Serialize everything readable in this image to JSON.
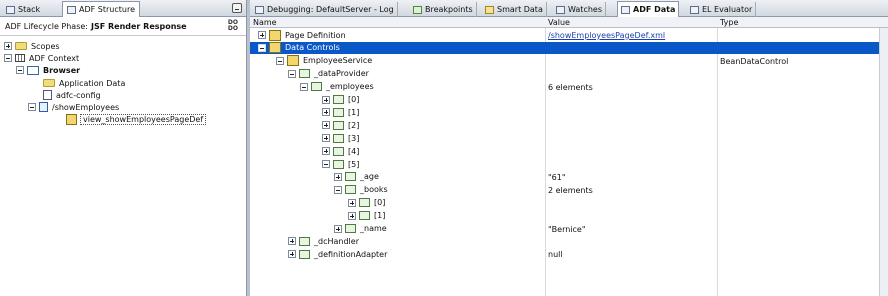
{
  "left_panel": {
    "tabs": [
      {
        "label": "Stack"
      },
      {
        "label": "ADF Structure"
      }
    ],
    "phase_label": "ADF Lifecycle Phase:",
    "phase_value": "JSF Render Response",
    "tree": [
      {
        "label": "Scopes"
      },
      {
        "label": "ADF Context"
      },
      {
        "label": "Browser"
      },
      {
        "label": "Application Data"
      },
      {
        "label": "adfc-config"
      },
      {
        "label": "/showEmployees"
      },
      {
        "label": "view_showEmployeesPageDef"
      }
    ]
  },
  "right_panel": {
    "tabs": [
      {
        "label": "Debugging: DefaultServer - Log"
      },
      {
        "label": "Breakpoints"
      },
      {
        "label": "Smart Data"
      },
      {
        "label": "Watches"
      },
      {
        "label": "ADF Data"
      },
      {
        "label": "EL Evaluator"
      }
    ],
    "columns": {
      "name": "Name",
      "value": "Value",
      "type": "Type"
    },
    "rows": [
      {
        "name": "Page Definition",
        "value": "/showEmployeesPageDef.xml",
        "type": ""
      },
      {
        "name": "Data Controls",
        "value": "",
        "type": ""
      },
      {
        "name": "EmployeeService",
        "value": "",
        "type": "BeanDataControl"
      },
      {
        "name": "_dataProvider",
        "value": "",
        "type": ""
      },
      {
        "name": "_employees",
        "value": "6 elements",
        "type": ""
      },
      {
        "name": "[0]",
        "value": "",
        "type": ""
      },
      {
        "name": "[1]",
        "value": "",
        "type": ""
      },
      {
        "name": "[2]",
        "value": "",
        "type": ""
      },
      {
        "name": "[3]",
        "value": "",
        "type": ""
      },
      {
        "name": "[4]",
        "value": "",
        "type": ""
      },
      {
        "name": "[5]",
        "value": "",
        "type": ""
      },
      {
        "name": "_age",
        "value": "\"61\"",
        "type": ""
      },
      {
        "name": "_books",
        "value": "2 elements",
        "type": ""
      },
      {
        "name": "[0]",
        "value": "",
        "type": ""
      },
      {
        "name": "[1]",
        "value": "",
        "type": ""
      },
      {
        "name": "_name",
        "value": "\"Bernice\"",
        "type": ""
      },
      {
        "name": "_dcHandler",
        "value": "",
        "type": ""
      },
      {
        "name": "_definitionAdapter",
        "value": "null",
        "type": ""
      }
    ]
  }
}
